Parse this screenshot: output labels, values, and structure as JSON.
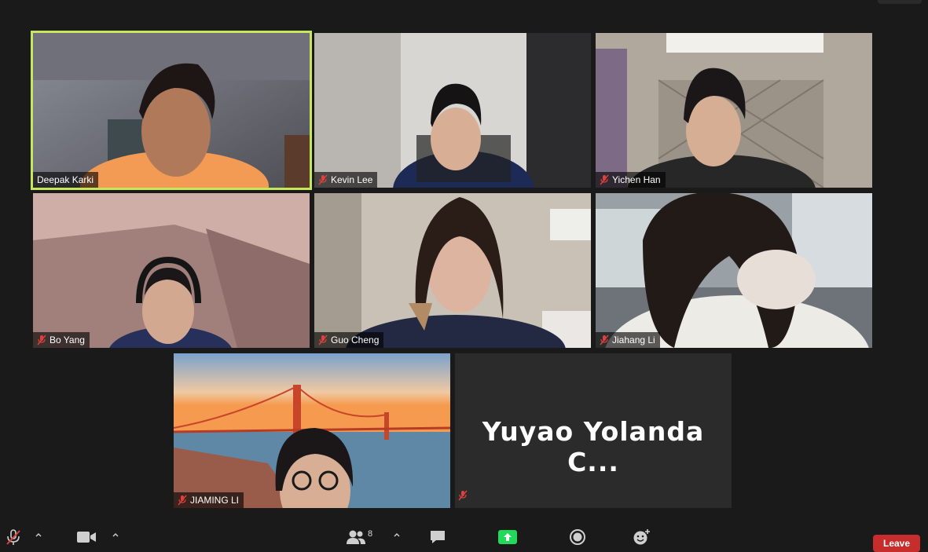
{
  "participants": [
    {
      "name": "Deepak Karki",
      "muted": false,
      "speaking": true
    },
    {
      "name": "Kevin Lee",
      "muted": true
    },
    {
      "name": "Yichen Han",
      "muted": true
    },
    {
      "name": "Bo Yang",
      "muted": true
    },
    {
      "name": "Guo Cheng",
      "muted": true
    },
    {
      "name": "Jiahang Li",
      "muted": true
    },
    {
      "name": "JIAMING LI",
      "muted": true
    },
    {
      "name": "Yuyao Yolanda C...",
      "muted": true,
      "video_off": true
    }
  ],
  "toolbar": {
    "participants_count": "8",
    "leave_label": "Leave"
  },
  "icons": {
    "mute": "mic-muted-icon",
    "video": "video-camera-icon",
    "participants": "participants-icon",
    "chat": "chat-icon",
    "share": "share-screen-icon",
    "record": "record-icon",
    "reactions": "reactions-icon"
  },
  "colors": {
    "speaking_border": "#c8e65a",
    "leave_button": "#c72d2d",
    "share_button": "#23d959",
    "muted_icon": "#e0403c"
  }
}
